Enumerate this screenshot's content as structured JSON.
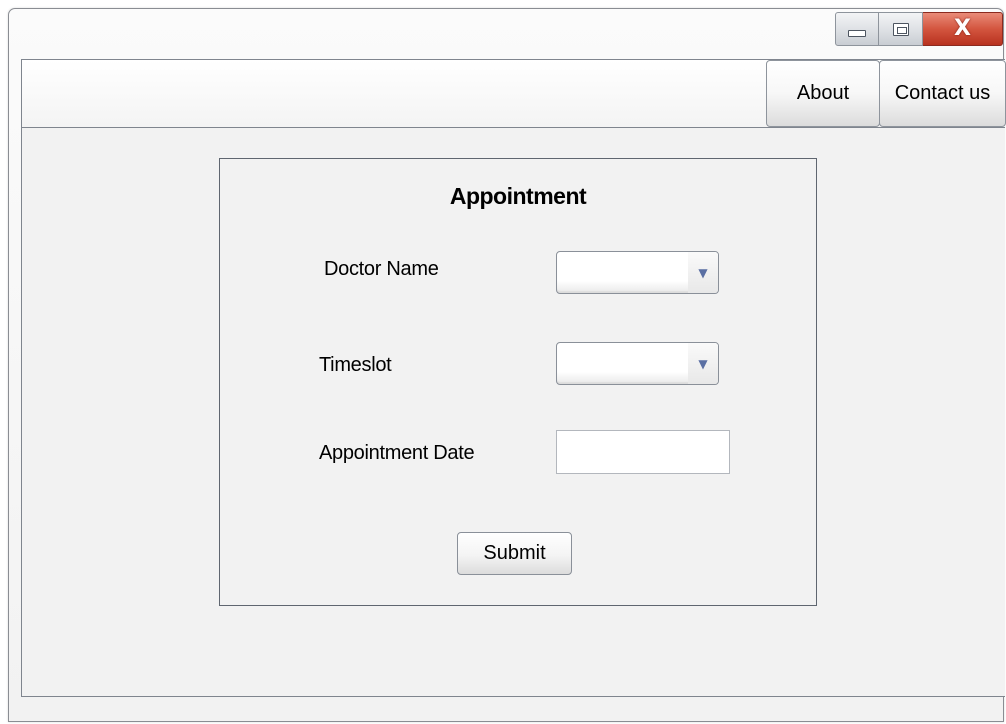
{
  "window": {
    "controls": {
      "minimize_icon": "minimize-icon",
      "maximize_icon": "maximize-icon",
      "close_glyph": "X",
      "close_color": "#d3553f"
    }
  },
  "nav": {
    "about_label": "About",
    "contact_label": "Contact us"
  },
  "form": {
    "title": "Appointment",
    "doctor_name": {
      "label": "Doctor Name",
      "value": ""
    },
    "timeslot": {
      "label": "Timeslot",
      "value": ""
    },
    "appointment_date": {
      "label": "Appointment Date",
      "value": "",
      "placeholder": ""
    },
    "submit_label": "Submit",
    "dropdown_arrow_color": "#5a6fa3"
  }
}
